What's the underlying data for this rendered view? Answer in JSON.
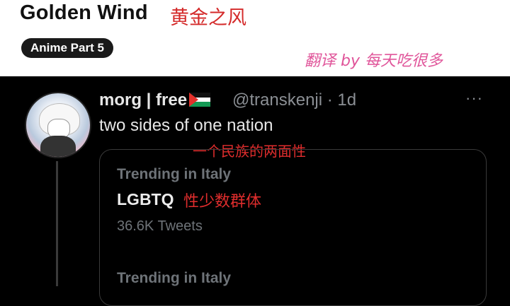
{
  "header": {
    "title": "Golden Wind",
    "title_cn": "黄金之风",
    "tag": "Anime Part 5",
    "credit": "翻译 by 每天吃很多"
  },
  "tweet": {
    "display_name": "morg | free",
    "flag_icon": "palestine-flag-icon",
    "handle_time": "@transkenji · 1d",
    "more": "···",
    "text": "two sides of one nation",
    "text_cn": "一个民族的两面性",
    "trends": [
      {
        "label": "Trending in Italy",
        "topic": "LGBTQ",
        "topic_cn": "性少数群体",
        "count": "36.6K Tweets"
      },
      {
        "label": "Trending in Italy"
      }
    ]
  }
}
